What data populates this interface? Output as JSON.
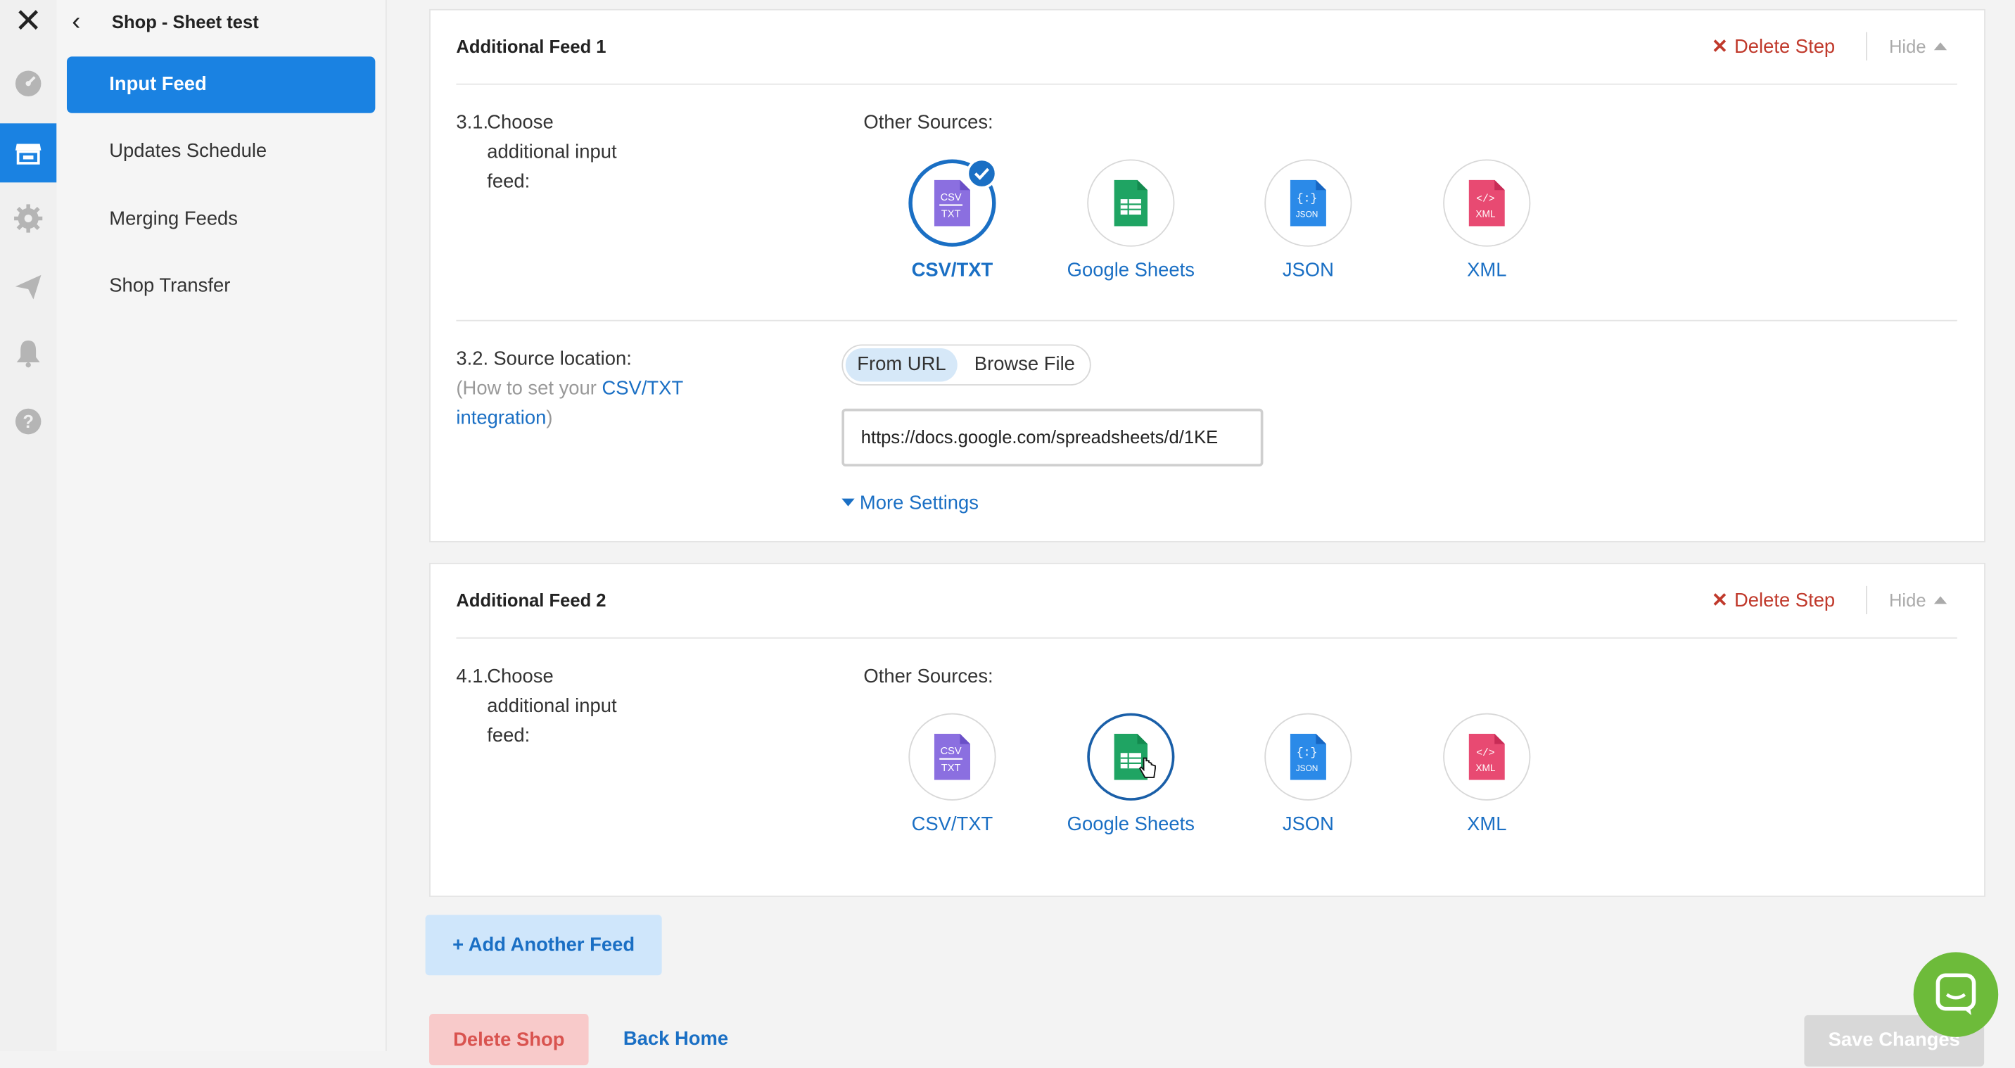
{
  "sidebar": {
    "shop_title": "Shop - Sheet test",
    "items": [
      {
        "label": "Input Feed"
      },
      {
        "label": "Updates Schedule"
      },
      {
        "label": "Merging Feeds"
      },
      {
        "label": "Shop Transfer"
      }
    ]
  },
  "feed1": {
    "title": "Additional Feed 1",
    "delete_label": "Delete Step",
    "hide_label": "Hide",
    "step_choose": {
      "num": "3.1.",
      "label": "Choose additional input feed:"
    },
    "other_sources": "Other Sources:",
    "sources": [
      "CSV/TXT",
      "Google Sheets",
      "JSON",
      "XML"
    ],
    "selected_source": "CSV/TXT",
    "step_location": {
      "num": "3.2.",
      "label": "Source location:"
    },
    "help_prefix": "(How to set your ",
    "help_link": "CSV/TXT integration",
    "help_suffix": ")",
    "toggle": [
      "From URL",
      "Browse File"
    ],
    "toggle_selected": "From URL",
    "url_value": "https://docs.google.com/spreadsheets/d/1KE",
    "more_settings": "More Settings"
  },
  "feed2": {
    "title": "Additional Feed 2",
    "delete_label": "Delete Step",
    "hide_label": "Hide",
    "step_choose": {
      "num": "4.1.",
      "label": "Choose additional input feed:"
    },
    "other_sources": "Other Sources:",
    "sources": [
      "CSV/TXT",
      "Google Sheets",
      "JSON",
      "XML"
    ],
    "hovered_source": "Google Sheets"
  },
  "footer": {
    "add_feed": "+ Add Another Feed",
    "delete_shop": "Delete Shop",
    "back_home": "Back Home",
    "save": "Save Changes"
  },
  "colors": {
    "accent": "#1a82e2",
    "link": "#1a6fc4",
    "danger": "#c0392b",
    "chat": "#6dbb3a"
  }
}
